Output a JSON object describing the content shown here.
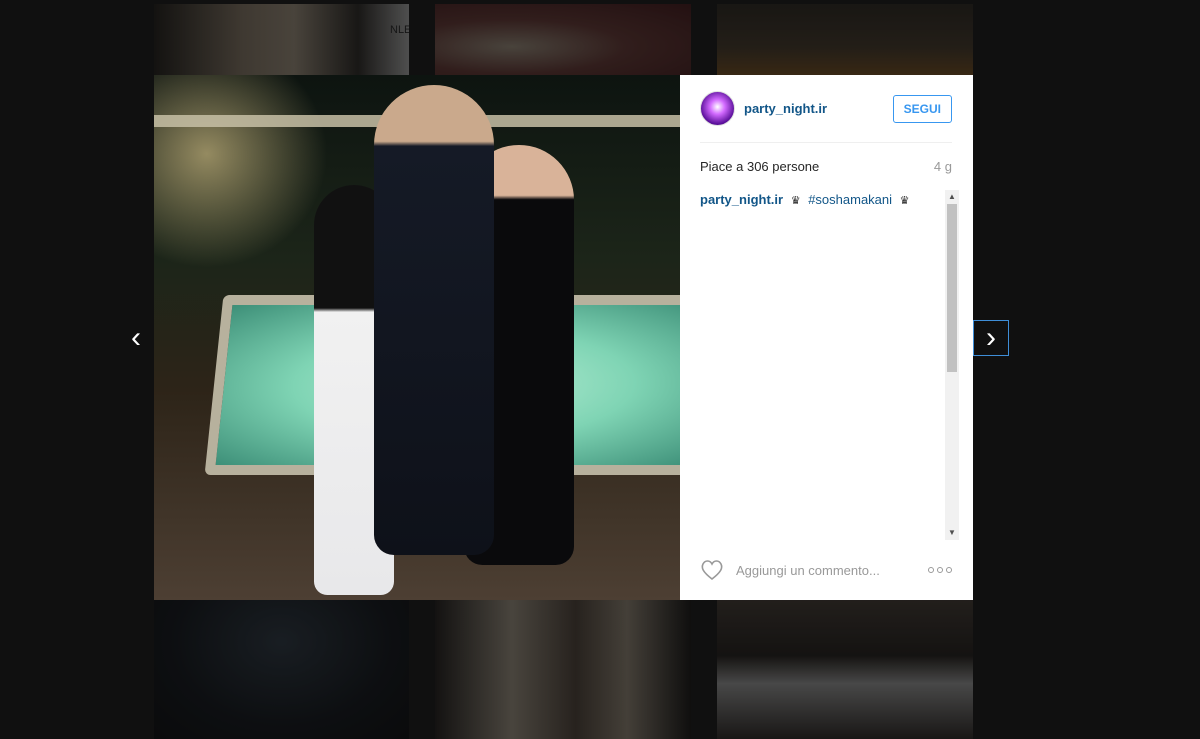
{
  "post": {
    "username": "party_night.ir",
    "follow_label": "SEGUI",
    "likes_text": "Piace a 306 persone",
    "age_text": "4 g",
    "caption_user": "party_night.ir",
    "caption_icon": "crown",
    "caption_hashtag": "#soshamakani",
    "comment_placeholder": "Aggiungi un commento...",
    "photo_sign_text": "NLE"
  },
  "navigation": {
    "prev_icon": "chevron-left-icon",
    "next_icon": "chevron-right-icon",
    "prev_glyph": "‹",
    "next_glyph": "›"
  },
  "colors": {
    "link": "#125688",
    "follow": "#3897f0",
    "focus_outline": "#3f8ed8"
  }
}
